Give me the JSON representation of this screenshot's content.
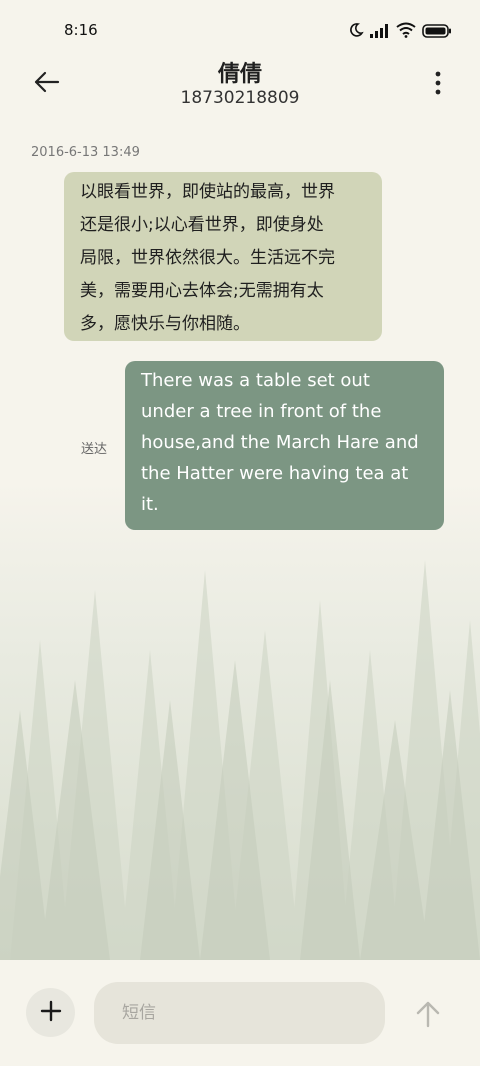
{
  "status": {
    "time": "8:16"
  },
  "header": {
    "contact_name": "倩倩",
    "contact_number": "18730218809"
  },
  "conversation": {
    "timestamp": "2016-6-13 13:49",
    "incoming_lines": [
      "以眼看世界，即使站的最高，世界",
      "还是很小;以心看世界，即使身处",
      "局限，世界依然很大。生活远不完",
      "美，需要用心去体会;无需拥有太",
      "多，愿快乐与你相随。"
    ],
    "outgoing_lines": [
      "There was a table set out",
      "under a tree in front of the",
      "house,and the March Hare and",
      "the Hatter were having tea at",
      "it."
    ],
    "delivery_status": "送达"
  },
  "composer": {
    "placeholder": "短信"
  },
  "colors": {
    "incoming_bubble": "#d1d5b8",
    "outgoing_bubble": "#7c9683",
    "background": "#f6f4ec"
  }
}
